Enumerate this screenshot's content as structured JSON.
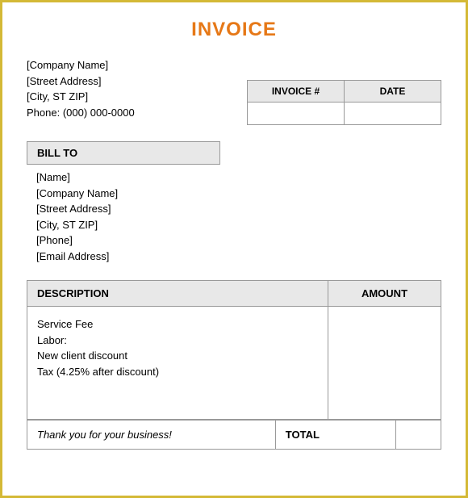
{
  "title": "INVOICE",
  "company": {
    "name": "[Company Name]",
    "street": "[Street Address]",
    "city": "[City, ST  ZIP]",
    "phone": "Phone: (000) 000-0000"
  },
  "meta": {
    "invoiceNumberLabel": "INVOICE #",
    "dateLabel": "DATE",
    "invoiceNumber": "",
    "date": ""
  },
  "billTo": {
    "header": "BILL TO",
    "name": "[Name]",
    "company": "[Company Name]",
    "street": "[Street Address]",
    "city": "[City, ST  ZIP]",
    "phone": "[Phone]",
    "email": "[Email Address]"
  },
  "table": {
    "descriptionHeader": "DESCRIPTION",
    "amountHeader": "AMOUNT",
    "lines": {
      "l1": "Service Fee",
      "l2": "Labor:",
      "l3": "New client discount",
      "l4": "Tax (4.25% after discount)"
    }
  },
  "footer": {
    "thankYou": "Thank you for your business!",
    "totalLabel": "TOTAL",
    "totalValue": ""
  }
}
